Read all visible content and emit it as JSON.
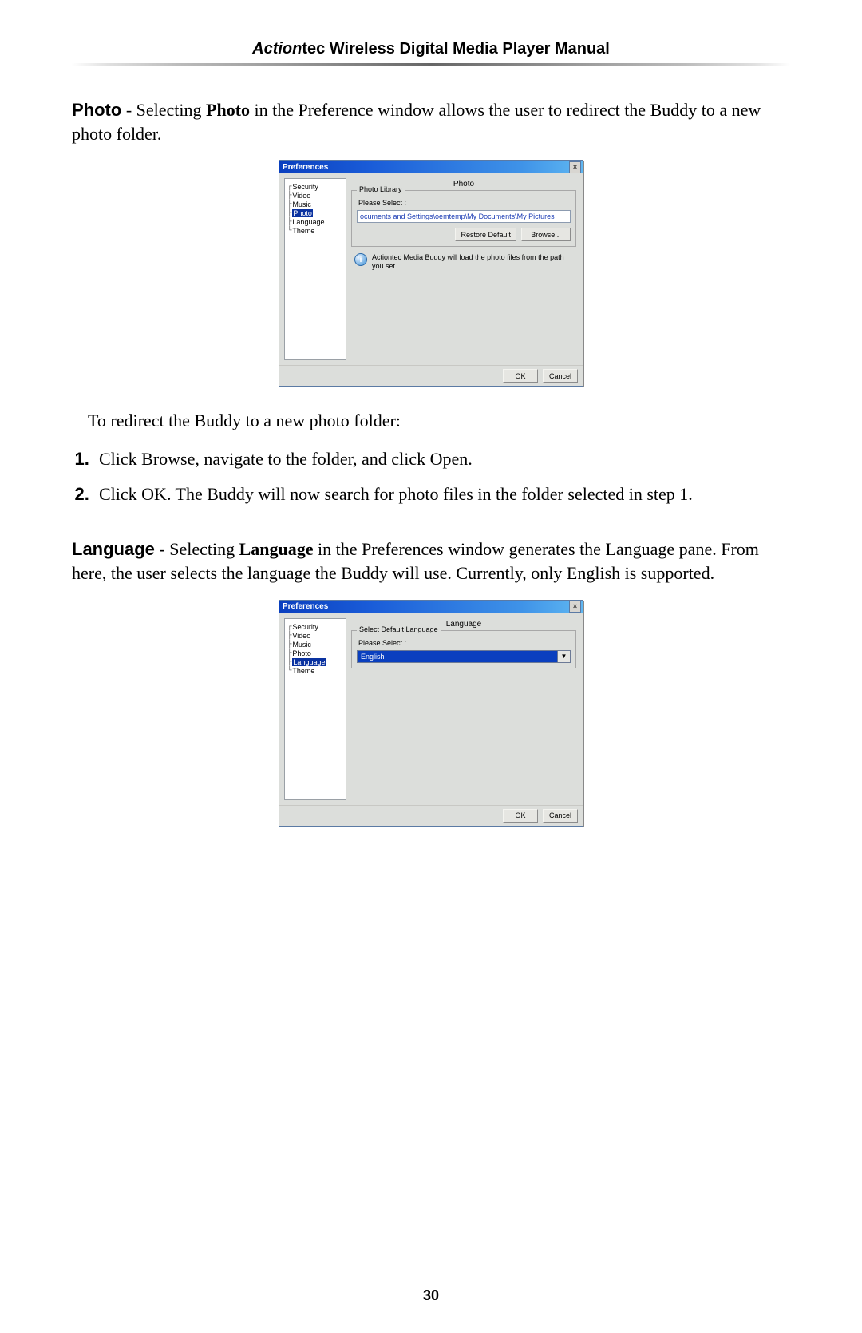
{
  "header": {
    "brand_italic": "Action",
    "brand_rest": "tec",
    "title_rest": " Wireless Digital Media Player Manual"
  },
  "section_photo": {
    "heading_bold": "Photo",
    "intro_pre": " - Selecting ",
    "intro_bold1": "Photo",
    "intro_post": " in the Preference window allows the user to redirect the Buddy to a new photo folder.",
    "redirect_line": "To redirect the Buddy to a new photo folder:",
    "step1_pre": "Click ",
    "step1_b1": "Browse",
    "step1_mid": ", navigate to the folder, and click ",
    "step1_b2": "Open",
    "step1_post": ".",
    "step2_pre": "Click ",
    "step2_b1": "OK",
    "step2_post": ". The Buddy will now search for photo files in the folder selected in step 1."
  },
  "section_language": {
    "heading_bold": "Language",
    "intro_pre": " - Selecting ",
    "intro_bold1": "Language",
    "intro_post": " in the Preferences window generates the Language pane. From here, the user selects the language the Buddy will use. Currently, only English is supported."
  },
  "dlg_common": {
    "title": "Preferences",
    "close": "×",
    "ok": "OK",
    "cancel": "Cancel",
    "please_select": "Please Select :",
    "tree": [
      "Security",
      "Video",
      "Music",
      "Photo",
      "Language",
      "Theme"
    ]
  },
  "dlg_photo": {
    "pane_title": "Photo",
    "fieldset_legend": "Photo Library",
    "path_value": "ocuments and Settings\\oemtemp\\My Documents\\My Pictures",
    "restore_btn": "Restore Default",
    "browse_btn": "Browse...",
    "info_text": "Actiontec Media Buddy will load the photo files from the path you set."
  },
  "dlg_language": {
    "pane_title": "Language",
    "fieldset_legend": "Select Default Language",
    "selected_value": "English"
  },
  "page_number": "30"
}
